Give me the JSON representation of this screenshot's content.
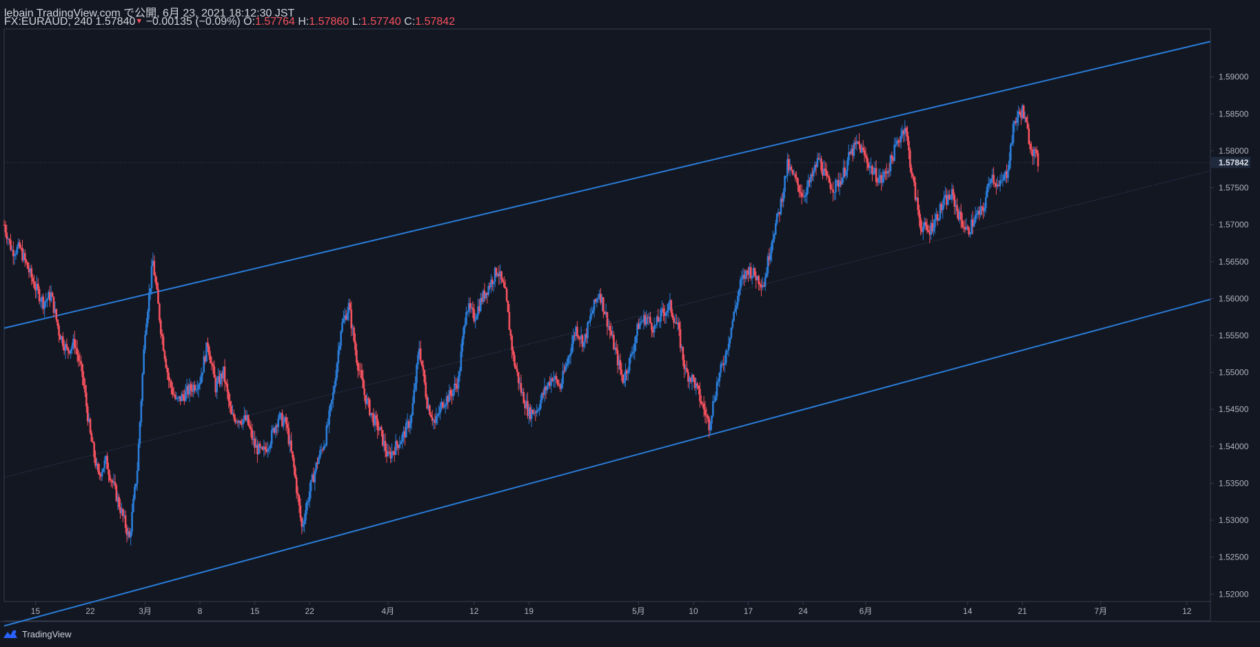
{
  "header": {
    "publish_line": "lebain TradingView.com で公開, 6月 23, 2021 18:12:30 JST",
    "symbol_interval": "FX:EURAUD, 240",
    "last": "1.57840",
    "change_arrow": "▼",
    "change": "−0.00135 (−0.09%)",
    "o_label": "O:",
    "o": "1.57764",
    "h_label": "H:",
    "h": "1.57860",
    "l_label": "L:",
    "l": "1.57740",
    "c_label": "C:",
    "c": "1.57842"
  },
  "footer": {
    "brand": "TradingView",
    "logo": "tradingview-logo-icon"
  },
  "colors": {
    "background": "#131722",
    "up": "#2a7dd9",
    "down": "#f7525f",
    "channel": "#2a7dd9",
    "text": "#d1d4dc",
    "axis_text": "#b2b5be",
    "frame": "#363c4e"
  },
  "chart_data": {
    "type": "candlestick",
    "symbol": "FX:EURAUD",
    "interval": "240",
    "ylim": [
      1.519,
      1.5965
    ],
    "y_ticks": [
      "1.52000",
      "1.52500",
      "1.53000",
      "1.53500",
      "1.54000",
      "1.54500",
      "1.55000",
      "1.55500",
      "1.56000",
      "1.56500",
      "1.57000",
      "1.57500",
      "1.58000",
      "1.58500",
      "1.59000"
    ],
    "current_price_label": "1.57842",
    "x_ticks": [
      {
        "label": "15",
        "x": "2021-02-15"
      },
      {
        "label": "22",
        "x": "2021-02-22"
      },
      {
        "label": "3月",
        "x": "2021-03-01"
      },
      {
        "label": "8",
        "x": "2021-03-08"
      },
      {
        "label": "15",
        "x": "2021-03-15"
      },
      {
        "label": "22",
        "x": "2021-03-22"
      },
      {
        "label": "4月",
        "x": "2021-04-01"
      },
      {
        "label": "12",
        "x": "2021-04-12"
      },
      {
        "label": "19",
        "x": "2021-04-19"
      },
      {
        "label": "5月",
        "x": "2021-05-03"
      },
      {
        "label": "10",
        "x": "2021-05-10"
      },
      {
        "label": "17",
        "x": "2021-05-17"
      },
      {
        "label": "24",
        "x": "2021-05-24"
      },
      {
        "label": "6月",
        "x": "2021-06-01"
      },
      {
        "label": "14",
        "x": "2021-06-14"
      },
      {
        "label": "21",
        "x": "2021-06-21"
      },
      {
        "label": "7月",
        "x": "2021-07-01"
      },
      {
        "label": "12",
        "x": "2021-07-12"
      }
    ],
    "price_path": [
      [
        "2021-02-11",
        1.57
      ],
      [
        "2021-02-12",
        1.5665
      ],
      [
        "2021-02-13",
        1.5668
      ],
      [
        "2021-02-15",
        1.5615
      ],
      [
        "2021-02-16",
        1.5595
      ],
      [
        "2021-02-17",
        1.5605
      ],
      [
        "2021-02-18",
        1.5555
      ],
      [
        "2021-02-19",
        1.553
      ],
      [
        "2021-02-20",
        1.554
      ],
      [
        "2021-02-21",
        1.5495
      ],
      [
        "2021-02-22",
        1.5415
      ],
      [
        "2021-02-23",
        1.536
      ],
      [
        "2021-02-24",
        1.538
      ],
      [
        "2021-02-25",
        1.5345
      ],
      [
        "2021-02-26",
        1.531
      ],
      [
        "2021-02-27",
        1.5275
      ],
      [
        "2021-02-28",
        1.537
      ],
      [
        "2021-03-01",
        1.556
      ],
      [
        "2021-03-02",
        1.565
      ],
      [
        "2021-03-03",
        1.556
      ],
      [
        "2021-03-04",
        1.549
      ],
      [
        "2021-03-05",
        1.546
      ],
      [
        "2021-03-06",
        1.547
      ],
      [
        "2021-03-08",
        1.549
      ],
      [
        "2021-03-09",
        1.554
      ],
      [
        "2021-03-10",
        1.548
      ],
      [
        "2021-03-11",
        1.55
      ],
      [
        "2021-03-12",
        1.544
      ],
      [
        "2021-03-14",
        1.5435
      ],
      [
        "2021-03-15",
        1.54
      ],
      [
        "2021-03-16",
        1.539
      ],
      [
        "2021-03-17",
        1.541
      ],
      [
        "2021-03-18",
        1.544
      ],
      [
        "2021-03-19",
        1.543
      ],
      [
        "2021-03-20",
        1.537
      ],
      [
        "2021-03-21",
        1.529
      ],
      [
        "2021-03-22",
        1.534
      ],
      [
        "2021-03-23",
        1.538
      ],
      [
        "2021-03-24",
        1.541
      ],
      [
        "2021-03-25",
        1.547
      ],
      [
        "2021-03-26",
        1.556
      ],
      [
        "2021-03-27",
        1.559
      ],
      [
        "2021-03-28",
        1.552
      ],
      [
        "2021-03-29",
        1.547
      ],
      [
        "2021-03-30",
        1.544
      ],
      [
        "2021-03-31",
        1.542
      ],
      [
        "2021-04-01",
        1.5385
      ],
      [
        "2021-04-02",
        1.54
      ],
      [
        "2021-04-03",
        1.5415
      ],
      [
        "2021-04-04",
        1.544
      ],
      [
        "2021-04-05",
        1.5535
      ],
      [
        "2021-04-06",
        1.546
      ],
      [
        "2021-04-07",
        1.543
      ],
      [
        "2021-04-08",
        1.546
      ],
      [
        "2021-04-09",
        1.547
      ],
      [
        "2021-04-10",
        1.549
      ],
      [
        "2021-04-11",
        1.559
      ],
      [
        "2021-04-12",
        1.5575
      ],
      [
        "2021-04-13",
        1.56
      ],
      [
        "2021-04-14",
        1.562
      ],
      [
        "2021-04-15",
        1.564
      ],
      [
        "2021-04-16",
        1.5605
      ],
      [
        "2021-04-17",
        1.552
      ],
      [
        "2021-04-18",
        1.5475
      ],
      [
        "2021-04-19",
        1.5445
      ],
      [
        "2021-04-20",
        1.545
      ],
      [
        "2021-04-21",
        1.5475
      ],
      [
        "2021-04-22",
        1.5495
      ],
      [
        "2021-04-23",
        1.548
      ],
      [
        "2021-04-24",
        1.552
      ],
      [
        "2021-04-25",
        1.556
      ],
      [
        "2021-04-26",
        1.554
      ],
      [
        "2021-04-27",
        1.558
      ],
      [
        "2021-04-28",
        1.561
      ],
      [
        "2021-04-29",
        1.557
      ],
      [
        "2021-04-30",
        1.553
      ],
      [
        "2021-05-01",
        1.549
      ],
      [
        "2021-05-02",
        1.552
      ],
      [
        "2021-05-03",
        1.5565
      ],
      [
        "2021-05-04",
        1.5575
      ],
      [
        "2021-05-05",
        1.556
      ],
      [
        "2021-05-06",
        1.558
      ],
      [
        "2021-05-07",
        1.559
      ],
      [
        "2021-05-08",
        1.556
      ],
      [
        "2021-05-09",
        1.55
      ],
      [
        "2021-05-10",
        1.549
      ],
      [
        "2021-05-11",
        1.546
      ],
      [
        "2021-05-12",
        1.543
      ],
      [
        "2021-05-13",
        1.5485
      ],
      [
        "2021-05-14",
        1.552
      ],
      [
        "2021-05-15",
        1.557
      ],
      [
        "2021-05-16",
        1.562
      ],
      [
        "2021-05-17",
        1.564
      ],
      [
        "2021-05-18",
        1.563
      ],
      [
        "2021-05-19",
        1.562
      ],
      [
        "2021-05-20",
        1.568
      ],
      [
        "2021-05-21",
        1.572
      ],
      [
        "2021-05-22",
        1.578
      ],
      [
        "2021-05-23",
        1.576
      ],
      [
        "2021-05-24",
        1.574
      ],
      [
        "2021-05-25",
        1.576
      ],
      [
        "2021-05-26",
        1.579
      ],
      [
        "2021-05-27",
        1.576
      ],
      [
        "2021-05-28",
        1.575
      ],
      [
        "2021-05-29",
        1.5765
      ],
      [
        "2021-05-30",
        1.5795
      ],
      [
        "2021-05-31",
        1.581
      ],
      [
        "2021-06-01",
        1.579
      ],
      [
        "2021-06-02",
        1.577
      ],
      [
        "2021-06-03",
        1.576
      ],
      [
        "2021-06-04",
        1.578
      ],
      [
        "2021-06-05",
        1.581
      ],
      [
        "2021-06-06",
        1.5835
      ],
      [
        "2021-06-07",
        1.576
      ],
      [
        "2021-06-08",
        1.57
      ],
      [
        "2021-06-09",
        1.569
      ],
      [
        "2021-06-10",
        1.571
      ],
      [
        "2021-06-11",
        1.573
      ],
      [
        "2021-06-12",
        1.574
      ],
      [
        "2021-06-13",
        1.571
      ],
      [
        "2021-06-14",
        1.569
      ],
      [
        "2021-06-15",
        1.571
      ],
      [
        "2021-06-16",
        1.572
      ],
      [
        "2021-06-17",
        1.577
      ],
      [
        "2021-06-18",
        1.575
      ],
      [
        "2021-06-19",
        1.577
      ],
      [
        "2021-06-20",
        1.584
      ],
      [
        "2021-06-21",
        1.5855
      ],
      [
        "2021-06-22",
        1.581
      ],
      [
        "2021-06-23",
        1.5784
      ]
    ],
    "channel": {
      "upper": [
        [
          "2021-02-11",
          1.556
        ],
        [
          "2021-07-15",
          1.5948
        ]
      ],
      "lower": [
        [
          "2021-02-11",
          1.5157
        ],
        [
          "2021-07-15",
          1.5599
        ]
      ],
      "mid": [
        [
          "2021-02-11",
          1.5358
        ],
        [
          "2021-07-15",
          1.5773
        ]
      ]
    }
  }
}
